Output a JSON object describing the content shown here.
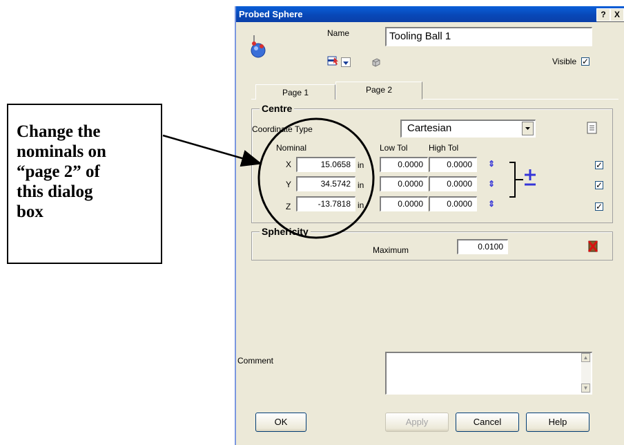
{
  "annotation": {
    "lines": [
      "Change the",
      "nominals on",
      "“page 2” of",
      "this dialog",
      "box"
    ]
  },
  "dialog": {
    "title": "Probed Sphere",
    "help_btn": "?",
    "close_btn": "X",
    "name_label": "Name",
    "name_value": "Tooling Ball 1",
    "visible_label": "Visible",
    "visible_checked": "✓",
    "tabs": [
      "Page 1",
      "Page 2"
    ],
    "centre": {
      "title": "Centre",
      "coord_type_label": "Coordinate Type",
      "coord_type_value": "Cartesian",
      "nominal_label": "Nominal",
      "low_tol_label": "Low Tol",
      "high_tol_label": "High Tol",
      "rows": [
        {
          "axis": "X",
          "nominal": "15.0658",
          "unit": "in",
          "low": "0.0000",
          "high": "0.0000",
          "checked": "✓"
        },
        {
          "axis": "Y",
          "nominal": "34.5742",
          "unit": "in",
          "low": "0.0000",
          "high": "0.0000",
          "checked": "✓"
        },
        {
          "axis": "Z",
          "nominal": "-13.7818",
          "unit": "in",
          "low": "0.0000",
          "high": "0.0000",
          "checked": "✓"
        }
      ]
    },
    "sphericity": {
      "title": "Sphericity",
      "maximum_label": "Maximum",
      "maximum_value": "0.0100"
    },
    "comment_label": "Comment",
    "comment_value": "",
    "buttons": {
      "ok": "OK",
      "apply": "Apply",
      "cancel": "Cancel",
      "help": "Help"
    }
  },
  "colors": {
    "titlebar": "#0a5fd8",
    "dialog_bg": "#ece9d8",
    "annotation_circle": "#000000"
  }
}
